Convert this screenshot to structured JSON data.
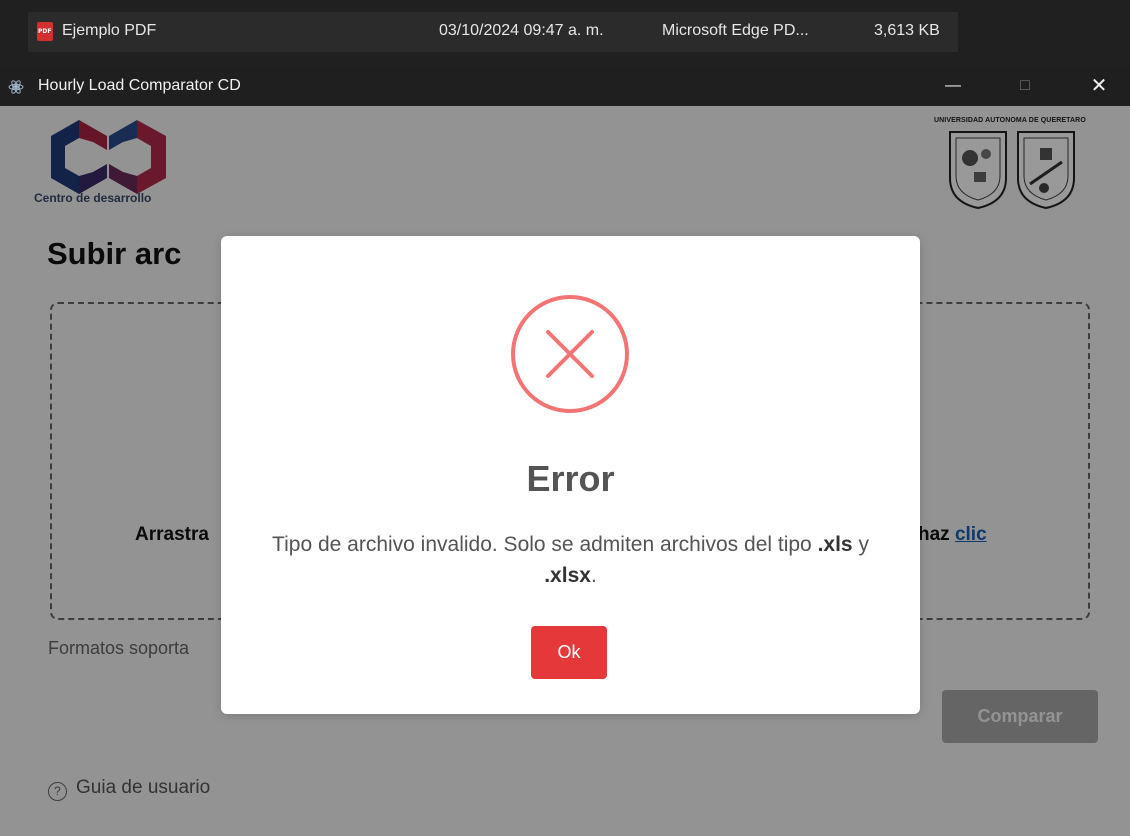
{
  "explorer": {
    "file_name": "Ejemplo PDF",
    "date": "03/10/2024 09:47 a. m.",
    "type": "Microsoft Edge PD...",
    "size": "3,613 KB",
    "file_icon": "pdf-icon"
  },
  "window": {
    "title": "Hourly Load Comparator CD",
    "minimize": "—",
    "maximize": "□",
    "close": "✕"
  },
  "header": {
    "logo_caption": "Centro de desarrollo",
    "university": "UNIVERSIDAD AUTONOMA DE QUERETARO"
  },
  "main": {
    "title": "Subir arc",
    "drop_prefix": "Arrastra",
    "drop_suffix": "haz ",
    "drop_link": "clic",
    "formats": "Formatos soporta",
    "compare_button": "Comparar",
    "guide_link": "Guia de usuario",
    "help_icon": "?"
  },
  "modal": {
    "icon": "error-x-icon",
    "title": "Error",
    "message_start": "Tipo de archivo invalido. Solo se admiten archivos del tipo ",
    "ext1": ".xls",
    "connector": " y ",
    "ext2": ".xlsx",
    "message_end": ".",
    "ok_button": "Ok"
  },
  "colors": {
    "error_red": "#f27474",
    "ok_button": "#e5383b",
    "link": "#1a5fb4"
  }
}
